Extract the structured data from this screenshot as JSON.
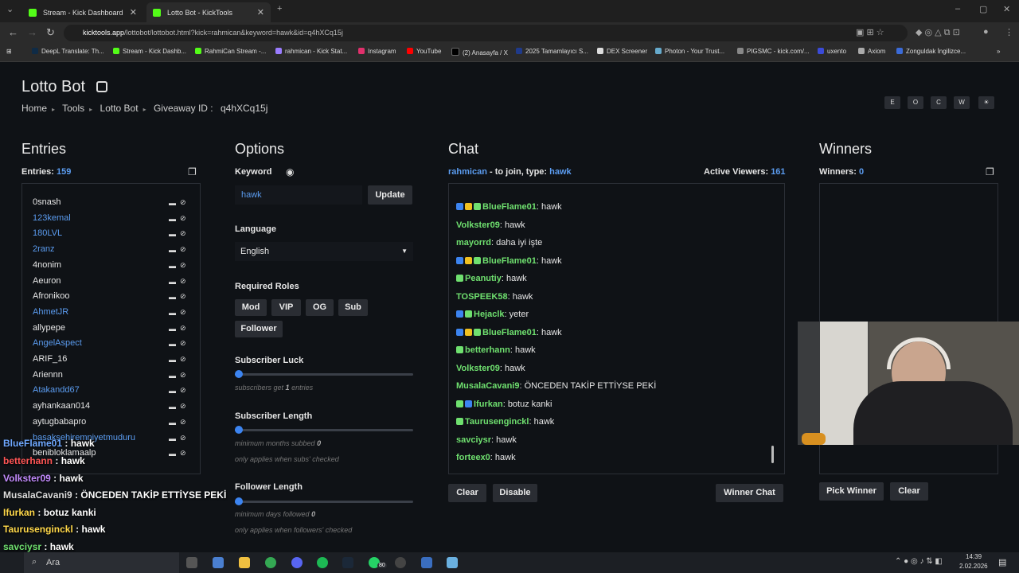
{
  "browser": {
    "tabs": [
      {
        "title": "Stream - Kick Dashboard",
        "active": false
      },
      {
        "title": "Lotto Bot - KickTools",
        "active": true
      }
    ],
    "url_domain": "kicktools.app",
    "url_path": "/lottobot/lottobot.html?kick=rahmican&keyword=hawk&id=q4hXCq15j",
    "bookmarks": [
      "DeepL Translate: Th...",
      "Stream - Kick Dashb...",
      "RahmiCan Stream -...",
      "rahmican - Kick Stat...",
      "Instagram",
      "YouTube",
      "(2) Anasayfa / X",
      "2025 Tamamlayıcı S...",
      "DEX Screener",
      "Photon - Your Trust...",
      "PIGSMC - kick.com/...",
      "uxento",
      "Axiom",
      "Zonguldak İngilizce..."
    ]
  },
  "page": {
    "title": "Lotto Bot",
    "breadcrumb": {
      "home": "Home",
      "tools": "Tools",
      "lotto": "Lotto Bot",
      "giveaway_label": "Giveaway ID :",
      "giveaway_id": "q4hXCq15j"
    },
    "theme_buttons": [
      "E",
      "O",
      "C",
      "W",
      "☀"
    ]
  },
  "entries": {
    "title": "Entries",
    "count_label": "Entries:",
    "count": "159",
    "list": [
      {
        "name": "0snash",
        "blue": false
      },
      {
        "name": "123kemal",
        "blue": true
      },
      {
        "name": "180LVL",
        "blue": true
      },
      {
        "name": "2ranz",
        "blue": true
      },
      {
        "name": "4nonim",
        "blue": false
      },
      {
        "name": "Aeuron",
        "blue": false
      },
      {
        "name": "Afronikoo",
        "blue": false
      },
      {
        "name": "AhmetJR",
        "blue": true
      },
      {
        "name": "allypepe",
        "blue": false
      },
      {
        "name": "AngelAspect",
        "blue": true
      },
      {
        "name": "ARIF_16",
        "blue": false
      },
      {
        "name": "Ariennn",
        "blue": false
      },
      {
        "name": "Atakandd67",
        "blue": true
      },
      {
        "name": "ayhankaan014",
        "blue": false
      },
      {
        "name": "aytugbabapro",
        "blue": false
      },
      {
        "name": "basaksehiremniyetmuduru",
        "blue": true
      },
      {
        "name": "benibloklamaalp",
        "blue": false
      }
    ]
  },
  "options": {
    "title": "Options",
    "keyword_label": "Keyword",
    "keyword_value": "hawk",
    "update_label": "Update",
    "language_label": "Language",
    "language_value": "English",
    "roles_label": "Required Roles",
    "roles": [
      "Mod",
      "VIP",
      "OG",
      "Sub",
      "Follower"
    ],
    "sub_luck_label": "Subscriber Luck",
    "sub_luck_hint_pre": "subscribers get",
    "sub_luck_value": "1",
    "sub_luck_hint_post": "entries",
    "sub_length_label": "Subscriber Length",
    "sub_length_hint_pre": "minimum months subbed",
    "sub_length_value": "0",
    "sub_length_note": "only applies when subs' checked",
    "fol_length_label": "Follower Length",
    "fol_length_hint_pre": "minimum days followed",
    "fol_length_value": "0",
    "fol_length_note": "only applies when followers' checked"
  },
  "chat": {
    "title": "Chat",
    "channel": "rahmican",
    "join_text": "- to join, type:",
    "keyword": "hawk",
    "viewers_label": "Active Viewers:",
    "viewers": "161",
    "messages": [
      {
        "user": "BlueFlame01",
        "text": "hawk",
        "color": "#6fe06f",
        "badges": [
          "#3c84f0",
          "#f0c020",
          "#6fe06f"
        ]
      },
      {
        "user": "Volkster09",
        "text": "hawk",
        "color": "#6fe06f",
        "badges": []
      },
      {
        "user": "mayorrd",
        "text": "daha iyi işte",
        "color": "#6fe06f",
        "badges": []
      },
      {
        "user": "BlueFlame01",
        "text": "hawk",
        "color": "#6fe06f",
        "badges": [
          "#3c84f0",
          "#f0c020",
          "#6fe06f"
        ]
      },
      {
        "user": "Peanutiy",
        "text": "hawk",
        "color": "#6fe06f",
        "badges": [
          "#6fe06f"
        ]
      },
      {
        "user": "TOSPEEK58",
        "text": "hawk",
        "color": "#6fe06f",
        "badges": []
      },
      {
        "user": "Hejaclk",
        "text": "yeter",
        "color": "#6fe06f",
        "badges": [
          "#3c84f0",
          "#6fe06f"
        ]
      },
      {
        "user": "BlueFlame01",
        "text": "hawk",
        "color": "#6fe06f",
        "badges": [
          "#3c84f0",
          "#f0c020",
          "#6fe06f"
        ]
      },
      {
        "user": "betterhann",
        "text": "hawk",
        "color": "#6fe06f",
        "badges": [
          "#6fe06f"
        ]
      },
      {
        "user": "Volkster09",
        "text": "hawk",
        "color": "#6fe06f",
        "badges": []
      },
      {
        "user": "MusalaCavani9",
        "text": "ÖNCEDEN TAKİP ETTİYSE PEKİ",
        "color": "#6fe06f",
        "badges": []
      },
      {
        "user": "Ifurkan",
        "text": "botuz kanki",
        "color": "#6fe06f",
        "badges": [
          "#6fe06f",
          "#3c84f0"
        ]
      },
      {
        "user": "Taurusenginckl",
        "text": "hawk",
        "color": "#6fe06f",
        "badges": [
          "#6fe06f"
        ]
      },
      {
        "user": "savciysr",
        "text": "hawk",
        "color": "#6fe06f",
        "badges": []
      },
      {
        "user": "forteex0",
        "text": "hawk",
        "color": "#6fe06f",
        "badges": []
      }
    ],
    "clear_label": "Clear",
    "disable_label": "Disable",
    "winner_chat_label": "Winner Chat"
  },
  "winners": {
    "title": "Winners",
    "count_label": "Winners:",
    "count": "0",
    "pick_label": "Pick Winner",
    "clear_label": "Clear"
  },
  "overlay_chat": [
    {
      "user": "BlueFlame01",
      "text": ": hawk"
    },
    {
      "user": "betterhann",
      "text": ": hawk"
    },
    {
      "user": "Volkster09",
      "text": ": hawk"
    },
    {
      "user": "MusalaCavani9",
      "text": ": ÖNCEDEN TAKİP ETTİYSE PEKİ"
    },
    {
      "user": "Ifurkan",
      "text": ": botuz kanki"
    },
    {
      "user": "Taurusenginckl",
      "text": ": hawk"
    },
    {
      "user": "savciysr",
      "text": ": hawk"
    }
  ],
  "taskbar": {
    "search_placeholder": "Ara",
    "time": "14:39",
    "date": "2.02.2026",
    "badge": "80"
  }
}
